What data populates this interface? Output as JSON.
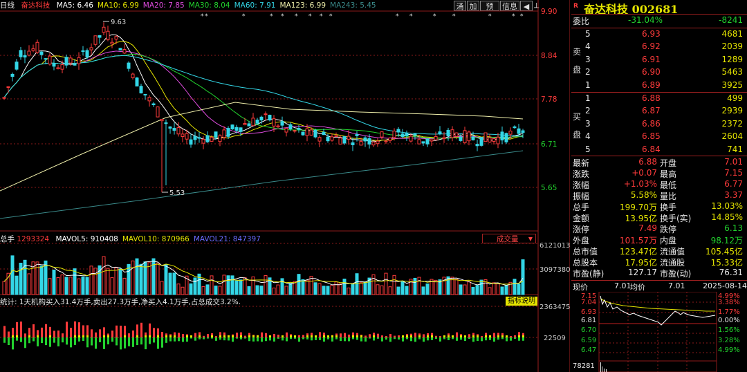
{
  "header": {
    "period": "日线",
    "name": "奋达科技",
    "ma": [
      {
        "label": "MA5",
        "value": "6.46",
        "color": "#ffffff"
      },
      {
        "label": "MA10",
        "value": "6.99",
        "color": "#e5e500"
      },
      {
        "label": "MA20",
        "value": "7.85",
        "color": "#e04ce0"
      },
      {
        "label": "MA30",
        "value": "8.04",
        "color": "#22d32e"
      },
      {
        "label": "MA60",
        "value": "7.91",
        "color": "#33d6e6"
      },
      {
        "label": "MA123",
        "value": "6.99",
        "color": "#eeeeaa"
      },
      {
        "label": "MA243",
        "value": "5.45",
        "color": "#3a8a8a"
      }
    ],
    "buttons": [
      "涌",
      "加",
      "预",
      "信息"
    ]
  },
  "axis": {
    "price_ticks": [
      "9.90",
      "8.84",
      "7.78",
      "6.71",
      "5.65"
    ],
    "volume_ticks": [
      "6121013",
      "3097380"
    ],
    "indicator_ticks": [
      "2363475",
      "22509"
    ]
  },
  "annotations": {
    "high": "9.63",
    "low": "5.53"
  },
  "volume_panel": {
    "label": "总手",
    "value": "1293324",
    "mavol": [
      {
        "label": "MAVOL5",
        "value": "910408",
        "color": "#ffffff"
      },
      {
        "label": "MAVOL10",
        "value": "870966",
        "color": "#e5e500"
      },
      {
        "label": "MAVOL21",
        "value": "847397",
        "color": "#6a6aff"
      }
    ],
    "dropdown": "成交量"
  },
  "indicator_panel": {
    "text": "统计: 1天机构买入31.4万手,卖出27.3万手,净买入4.1万手,占总成交3.2%.",
    "button": "指标说明"
  },
  "quote": {
    "code_badge": "R",
    "title": "奋达科技 002681",
    "weibi_label": "委比",
    "weibi": "-31.04%",
    "weicha": "-8241",
    "sell_label": [
      "卖",
      "盘"
    ],
    "buy_label": [
      "买",
      "盘"
    ],
    "sell": [
      {
        "level": "5",
        "price": "6.93",
        "vol": "4681"
      },
      {
        "level": "4",
        "price": "6.92",
        "vol": "2039"
      },
      {
        "level": "3",
        "price": "6.91",
        "vol": "1289"
      },
      {
        "level": "2",
        "price": "6.90",
        "vol": "5463"
      },
      {
        "level": "1",
        "price": "6.89",
        "vol": "3925"
      }
    ],
    "buy": [
      {
        "level": "1",
        "price": "6.88",
        "vol": "499"
      },
      {
        "level": "2",
        "price": "6.87",
        "vol": "2939"
      },
      {
        "level": "3",
        "price": "6.86",
        "vol": "2372"
      },
      {
        "level": "4",
        "price": "6.85",
        "vol": "2604"
      },
      {
        "level": "5",
        "price": "6.84",
        "vol": "741"
      }
    ],
    "stats": [
      {
        "l1": "最新",
        "v1": "6.88",
        "c1": "#ff3b3b",
        "l2": "开盘",
        "v2": "7.01",
        "c2": "#ff3b3b"
      },
      {
        "l1": "涨跌",
        "v1": "+0.07",
        "c1": "#ff3b3b",
        "l2": "最高",
        "v2": "7.15",
        "c2": "#ff3b3b"
      },
      {
        "l1": "涨幅",
        "v1": "+1.03%",
        "c1": "#ff3b3b",
        "l2": "最低",
        "v2": "6.77",
        "c2": "#ff3b3b"
      },
      {
        "l1": "振幅",
        "v1": "5.58%",
        "c1": "#e5e500",
        "l2": "量比",
        "v2": "3.37",
        "c2": "#ff3b3b"
      },
      {
        "l1": "总手",
        "v1": "199.70万",
        "c1": "#e5e500",
        "l2": "换手",
        "v2": "13.03%",
        "c2": "#e5e500"
      },
      {
        "l1": "金额",
        "v1": "13.95亿",
        "c1": "#e5e500",
        "l2": "换手(实)",
        "v2": "14.85%",
        "c2": "#e5e500"
      },
      {
        "l1": "涨停",
        "v1": "7.49",
        "c1": "#ff3b3b",
        "l2": "跌停",
        "v2": "6.13",
        "c2": "#22d32e"
      },
      {
        "l1": "外盘",
        "v1": "101.57万",
        "c1": "#ff3b3b",
        "l2": "内盘",
        "v2": "98.12万",
        "c2": "#22d32e"
      },
      {
        "l1": "总市值",
        "v1": "123.47亿",
        "c1": "#e5e500",
        "l2": "流通值",
        "v2": "105.45亿",
        "c2": "#e5e500"
      },
      {
        "l1": "总股本",
        "v1": "17.95亿",
        "c1": "#e5e500",
        "l2": "流通股",
        "v2": "15.33亿",
        "c2": "#e5e500"
      },
      {
        "l1": "市盈(静)",
        "v1": "127.17",
        "c1": "#e8e8e8",
        "l2": "市盈(动)",
        "v2": "76.31",
        "c2": "#e8e8e8"
      }
    ]
  },
  "mini": {
    "price_label": "现价",
    "price": "7.01",
    "avg_label": "均价",
    "avg": "7.01",
    "date": "2025-08-14",
    "left_ticks": [
      "7.15",
      "7.04",
      "6.93",
      "6.81",
      "6.70",
      "6.59",
      "6.47"
    ],
    "right_ticks": [
      "4.99%",
      "3.38%",
      "1.77%",
      "0.00%",
      "1.56%",
      "3.28%",
      "4.99%"
    ],
    "volume_label": "78281"
  },
  "colors": {
    "up": "#ff3b3b",
    "down": "#33d6e6",
    "grid": "#8b1a1a",
    "bg": "#000000"
  }
}
